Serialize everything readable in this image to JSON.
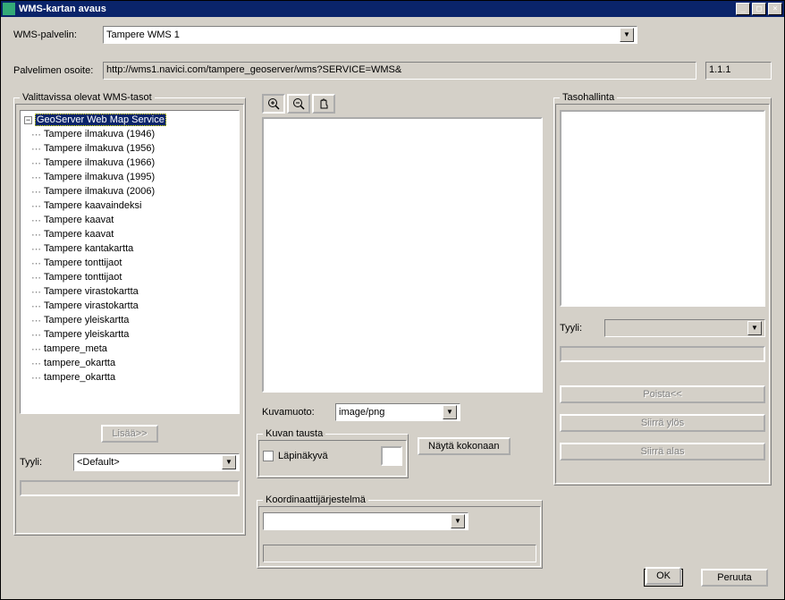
{
  "window": {
    "title": "WMS-kartan avaus",
    "min": "_",
    "max": "□",
    "close": "×"
  },
  "form": {
    "server_label": "WMS-palvelin:",
    "server_value": "Tampere WMS 1",
    "address_label": "Palvelimen osoite:",
    "address_value": "http://wms1.navici.com/tampere_geoserver/wms?SERVICE=WMS&",
    "version": "1.1.1"
  },
  "layers_group": {
    "title": "Valittavissa olevat WMS-tasot",
    "root": "GeoServer Web Map Service",
    "children": [
      "Tampere ilmakuva (1946)",
      "Tampere ilmakuva (1956)",
      "Tampere ilmakuva (1966)",
      "Tampere ilmakuva (1995)",
      "Tampere ilmakuva (2006)",
      "Tampere kaavaindeksi",
      "Tampere kaavat",
      "Tampere kaavat",
      "Tampere kantakartta",
      "Tampere tonttijaot",
      "Tampere tonttijaot",
      "Tampere virastokartta",
      "Tampere virastokartta",
      "Tampere yleiskartta",
      "Tampere yleiskartta",
      "tampere_meta",
      "tampere_okartta",
      "tampere_okartta"
    ],
    "add_button": "Lisää>>",
    "style_label": "Tyyli:",
    "style_value": "<Default>"
  },
  "middle": {
    "tools": {
      "zoom_in": "zoom-in",
      "zoom_out": "zoom-out",
      "pan": "pan"
    },
    "format_label": "Kuvamuoto:",
    "format_value": "image/png",
    "bg_group": "Kuvan tausta",
    "transparent_label": "Läpinäkyvä",
    "show_whole": "Näytä kokonaan",
    "crs_group": "Koordinaattijärjestelmä",
    "crs_value": ""
  },
  "right": {
    "group_title": "Tasohallinta",
    "style_label": "Tyyli:",
    "style_value": "",
    "remove": "Poista<<",
    "up": "Siirrä ylös",
    "down": "Siirrä alas"
  },
  "buttons": {
    "ok": "OK",
    "cancel": "Peruuta"
  }
}
